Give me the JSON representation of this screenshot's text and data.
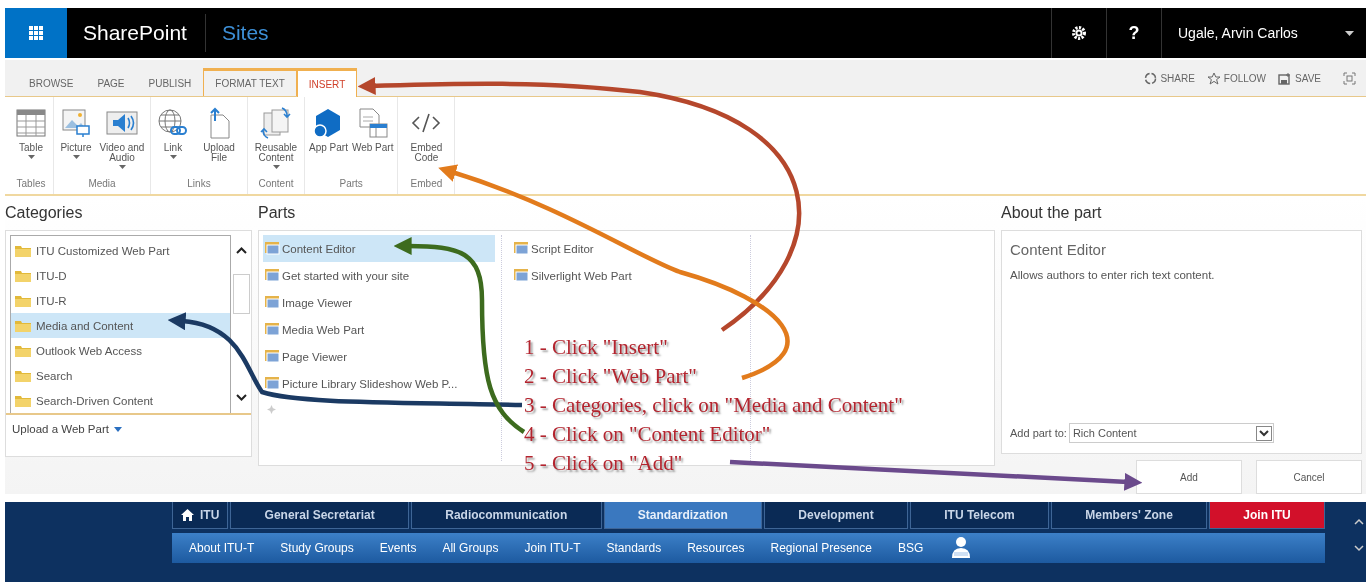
{
  "topbar": {
    "app_name": "SharePoint",
    "site_link": "Sites",
    "user": "Ugale, Arvin Carlos",
    "help": "?"
  },
  "ribbon_tabs": [
    {
      "label": "BROWSE",
      "selected": false,
      "contextual": false
    },
    {
      "label": "PAGE",
      "selected": false,
      "contextual": false
    },
    {
      "label": "PUBLISH",
      "selected": false,
      "contextual": false
    },
    {
      "label": "FORMAT TEXT",
      "selected": false,
      "contextual": true
    },
    {
      "label": "INSERT",
      "selected": true,
      "contextual": true
    }
  ],
  "page_actions": [
    "SHARE",
    "FOLLOW",
    "SAVE"
  ],
  "ribbon_groups": [
    {
      "label": "Tables",
      "commands": [
        {
          "label": "Table",
          "kind": "table",
          "dropdown": true
        }
      ]
    },
    {
      "label": "Media",
      "commands": [
        {
          "label": "Picture",
          "kind": "picture",
          "dropdown": true
        },
        {
          "label": "Video and Audio",
          "kind": "video",
          "dropdown": true
        }
      ]
    },
    {
      "label": "Links",
      "commands": [
        {
          "label": "Link",
          "kind": "link",
          "dropdown": true
        },
        {
          "label": "Upload File",
          "kind": "upload",
          "dropdown": false
        }
      ]
    },
    {
      "label": "Content",
      "commands": [
        {
          "label": "Reusable Content",
          "kind": "reusable",
          "dropdown": true
        }
      ]
    },
    {
      "label": "Parts",
      "commands": [
        {
          "label": "App Part",
          "kind": "app",
          "dropdown": false
        },
        {
          "label": "Web Part",
          "kind": "webpart",
          "dropdown": false
        }
      ]
    },
    {
      "label": "Embed",
      "commands": [
        {
          "label": "Embed Code",
          "kind": "embed",
          "dropdown": false
        }
      ]
    }
  ],
  "categories": {
    "title": "Categories",
    "items": [
      {
        "label": "ITU Customized Web Part",
        "selected": false
      },
      {
        "label": "ITU-D",
        "selected": false
      },
      {
        "label": "ITU-R",
        "selected": false
      },
      {
        "label": "Media and Content",
        "selected": true
      },
      {
        "label": "Outlook Web Access",
        "selected": false
      },
      {
        "label": "Search",
        "selected": false
      },
      {
        "label": "Search-Driven Content",
        "selected": false
      }
    ],
    "upload_link": "Upload a Web Part"
  },
  "parts": {
    "title": "Parts",
    "columns": [
      [
        {
          "label": "Content Editor",
          "selected": true
        },
        {
          "label": "Get started with your site",
          "selected": false
        },
        {
          "label": "Image Viewer",
          "selected": false
        },
        {
          "label": "Media Web Part",
          "selected": false
        },
        {
          "label": "Page Viewer",
          "selected": false
        },
        {
          "label": "Picture Library Slideshow Web P...",
          "selected": false
        }
      ],
      [
        {
          "label": "Script Editor",
          "selected": false
        },
        {
          "label": "Silverlight Web Part",
          "selected": false
        }
      ]
    ]
  },
  "about": {
    "title": "About the part",
    "part_name": "Content Editor",
    "description": "Allows authors to enter rich text content.",
    "add_to_label": "Add part to:",
    "add_to_value": "Rich Content"
  },
  "buttons": [
    "Add",
    "Cancel"
  ],
  "site_nav": {
    "tabs": [
      {
        "label": "ITU",
        "selected": false,
        "kind": "home"
      },
      {
        "label": "General Secretariat",
        "selected": false,
        "kind": "normal"
      },
      {
        "label": "Radiocommunication",
        "selected": false,
        "kind": "normal"
      },
      {
        "label": "Standardization",
        "selected": true,
        "kind": "normal"
      },
      {
        "label": "Development",
        "selected": false,
        "kind": "normal"
      },
      {
        "label": "ITU Telecom",
        "selected": false,
        "kind": "normal"
      },
      {
        "label": "Members' Zone",
        "selected": false,
        "kind": "normal"
      },
      {
        "label": "Join ITU",
        "selected": false,
        "kind": "highlight"
      }
    ],
    "links": [
      "About ITU-T",
      "Study Groups",
      "Events",
      "All Groups",
      "Join ITU-T",
      "Standards",
      "Resources",
      "Regional Presence",
      "BSG"
    ]
  },
  "instructions": [
    {
      "text": "1 - Click \"Insert\"",
      "color": "#b5472c"
    },
    {
      "text": "2 - Click \"Web Part\"",
      "color": "#e27b1c"
    },
    {
      "text": "3 - Categories, click on \"Media and Content\"",
      "color": "#1b3a63"
    },
    {
      "text": "4 - Click on \"Content Editor\"",
      "color": "#3d6b1e"
    },
    {
      "text": "5 - Click on \"Add\"",
      "color": "#6b4a8c"
    }
  ]
}
